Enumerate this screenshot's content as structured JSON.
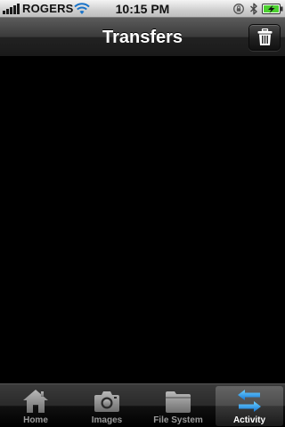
{
  "status_bar": {
    "carrier": "ROGERS",
    "time": "10:15 PM",
    "icons": [
      "signal-icon",
      "wifi-icon",
      "rotation-lock-icon",
      "bluetooth-icon",
      "battery-charging-icon"
    ]
  },
  "nav_bar": {
    "title": "Transfers",
    "trash_icon": "trash-icon"
  },
  "tab_bar": {
    "tabs": [
      {
        "label": "Home",
        "icon": "home-icon",
        "selected": false
      },
      {
        "label": "Images",
        "icon": "camera-icon",
        "selected": false
      },
      {
        "label": "File System",
        "icon": "folder-icon",
        "selected": false
      },
      {
        "label": "Activity",
        "icon": "transfer-arrows-icon",
        "selected": true
      }
    ]
  },
  "colors": {
    "selected_tab_icon": "#1e9be8",
    "unselected_tab_icon": "#8a8a8a",
    "battery_fill": "#4cd130"
  }
}
